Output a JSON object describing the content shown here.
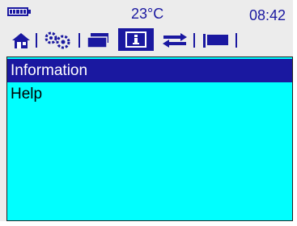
{
  "status": {
    "battery_icon": "battery-full-icon",
    "temperature": "23°C",
    "time": "08:42"
  },
  "tabs": [
    {
      "icon": "home-icon",
      "selected": false
    },
    {
      "icon": "settings-gears-icon",
      "selected": false
    },
    {
      "icon": "windows-icon",
      "selected": false
    },
    {
      "icon": "info-icon",
      "selected": true
    },
    {
      "icon": "transfer-arrows-icon",
      "selected": false
    },
    {
      "icon": "flag-icon",
      "selected": false
    }
  ],
  "menu": {
    "items": [
      {
        "label": "Information",
        "selected": true
      },
      {
        "label": "Help",
        "selected": false
      }
    ]
  },
  "colors": {
    "accent": "#1a18a0",
    "content_background": "#00ffff",
    "panel_background": "#ececec"
  }
}
